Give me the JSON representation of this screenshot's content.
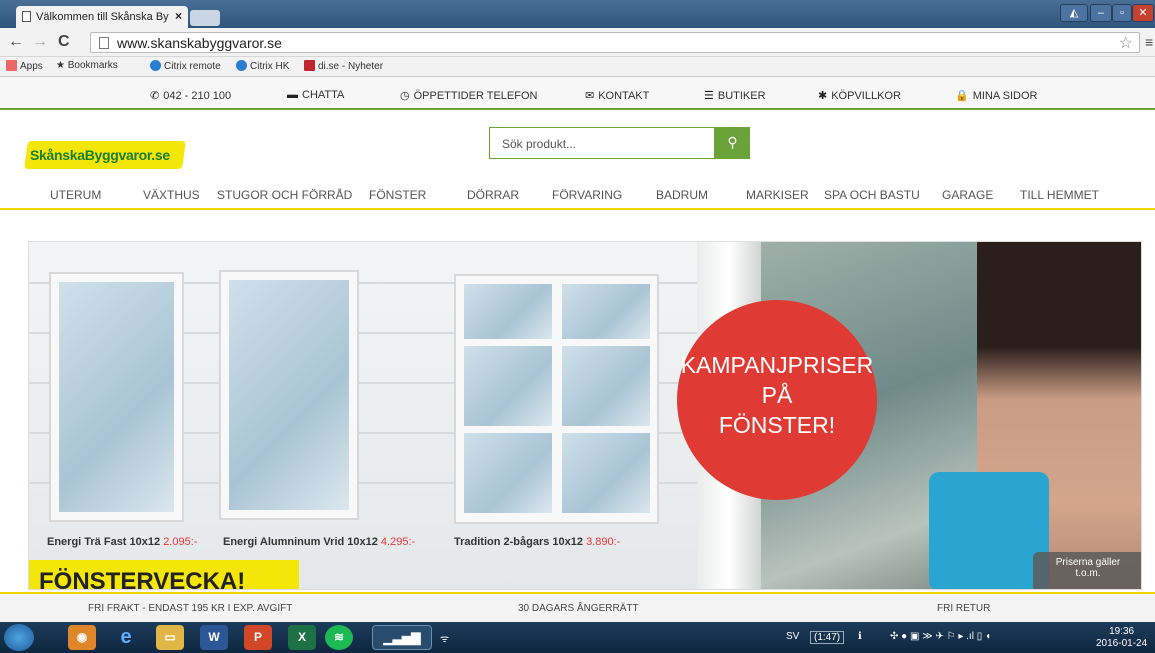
{
  "browser": {
    "tab_title": "Välkommen till Skånska By",
    "tab_close": "×",
    "url": "www.skanskabyggvaror.se"
  },
  "bookmarks": [
    {
      "label": "Apps",
      "icon": "apps-grid-icon"
    },
    {
      "label": "Bookmarks",
      "icon": "star-icon"
    },
    {
      "label": "Citrix remote",
      "icon": "citrix-icon"
    },
    {
      "label": "Citrix HK",
      "icon": "citrix-icon"
    },
    {
      "label": "di.se - Nyheter",
      "icon": "di-logo-icon"
    }
  ],
  "topbar": {
    "phone": "042 - 210 100",
    "chat": "CHATTA",
    "hours": "ÖPPETTIDER TELEFON",
    "contact": "KONTAKT",
    "stores": "BUTIKER",
    "terms": "KÖPVILLKOR",
    "my_pages": "MINA SIDOR"
  },
  "logo": "SkånskaByggvaror.se",
  "search": {
    "placeholder": "Sök produkt..."
  },
  "categories": [
    "UTERUM",
    "VÄXTHUS",
    "STUGOR OCH FÖRRÅD",
    "FÖNSTER",
    "DÖRRAR",
    "FÖRVARING",
    "BADRUM",
    "MARKISER",
    "SPA OCH BASTU",
    "GARAGE",
    "TILL HEMMET"
  ],
  "hero": {
    "circle_line1": "KAMPANJPRISER",
    "circle_line2": "PÅ",
    "circle_line3": "FÖNSTER!",
    "banner": "FÖNSTERVECKA!",
    "price_note_line1": "Priserna gäller",
    "price_note_line2": "t.o.m.",
    "products": [
      {
        "name": "Energi Trä Fast 10x12",
        "price": "2.095:-"
      },
      {
        "name": "Energi Alumninum Vrid 10x12",
        "price": "4.295:-"
      },
      {
        "name": "Tradition 2-bågars 10x12",
        "price": "3.890:-"
      }
    ]
  },
  "footer": {
    "shipping": "FRI FRAKT - ENDAST 195 KR I EXP. AVGIFT",
    "returns_days": "30 DAGARS ÅNGERRÄTT",
    "free_return": "FRI RETUR"
  },
  "taskbar": {
    "lang": "SV",
    "battery": "(1:47)",
    "time": "19:36",
    "date": "2016-01-24"
  },
  "colors": {
    "brand_green": "#6aa33a",
    "brand_yellow": "#f5e60a",
    "campaign_red": "#df3a33"
  }
}
